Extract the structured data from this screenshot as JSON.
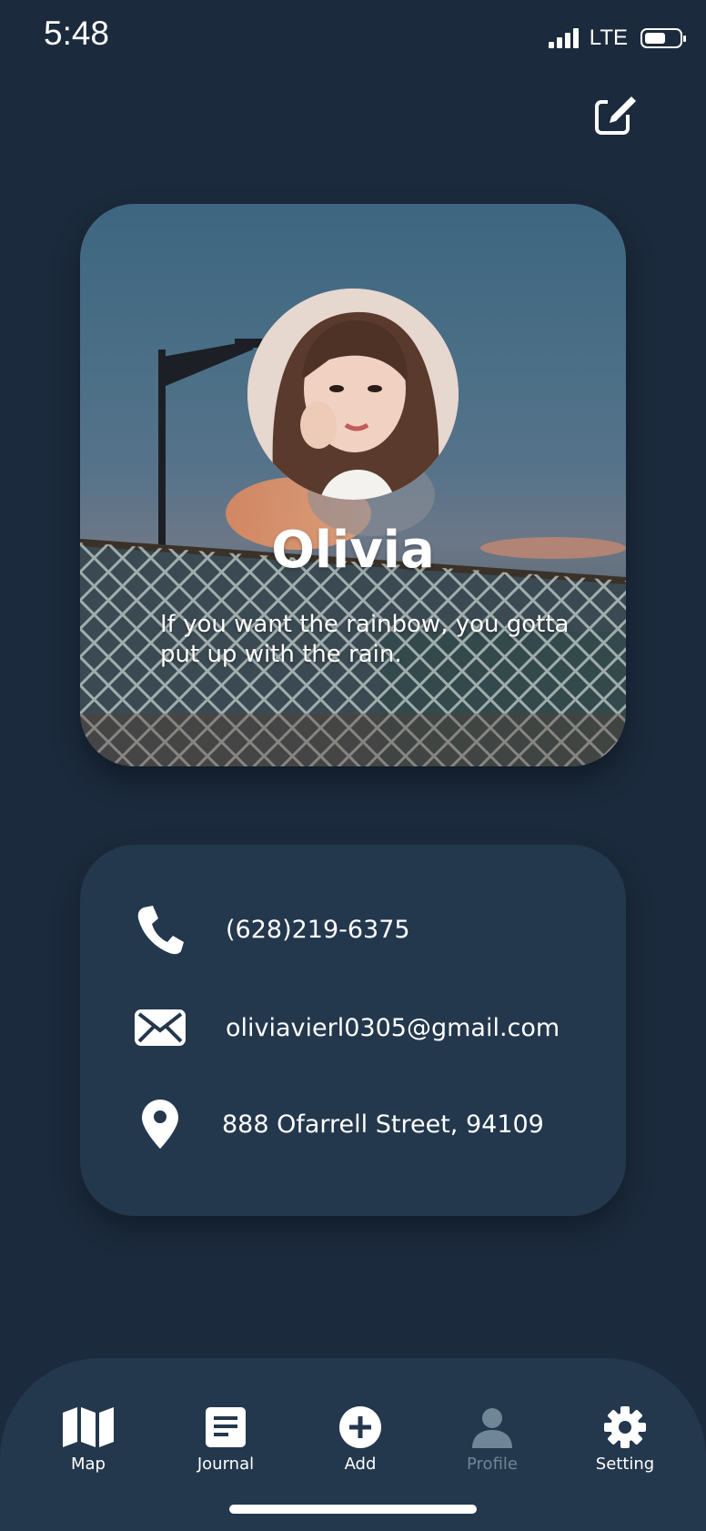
{
  "status_bar": {
    "time": "5:48",
    "network": "LTE",
    "battery_level": 0.6
  },
  "header": {
    "edit_icon": "edit-icon"
  },
  "profile": {
    "name": "Olivia",
    "bio": "If you want the rainbow, you gotta put up with the rain."
  },
  "contact": {
    "phone": "(628)219-6375",
    "email": "oliviavierl0305@gmail.com",
    "address": "888 Ofarrell Street, 94109"
  },
  "tabs": [
    {
      "label": "Map",
      "icon": "map-icon",
      "active": false
    },
    {
      "label": "Journal",
      "icon": "journal-icon",
      "active": false
    },
    {
      "label": "Add",
      "icon": "add-icon",
      "active": false
    },
    {
      "label": "Profile",
      "icon": "profile-icon",
      "active": true
    },
    {
      "label": "Setting",
      "icon": "gear-icon",
      "active": false
    }
  ],
  "colors": {
    "background": "#1b2a3c",
    "card": "#23374d",
    "active_tab": "#6e8695"
  }
}
